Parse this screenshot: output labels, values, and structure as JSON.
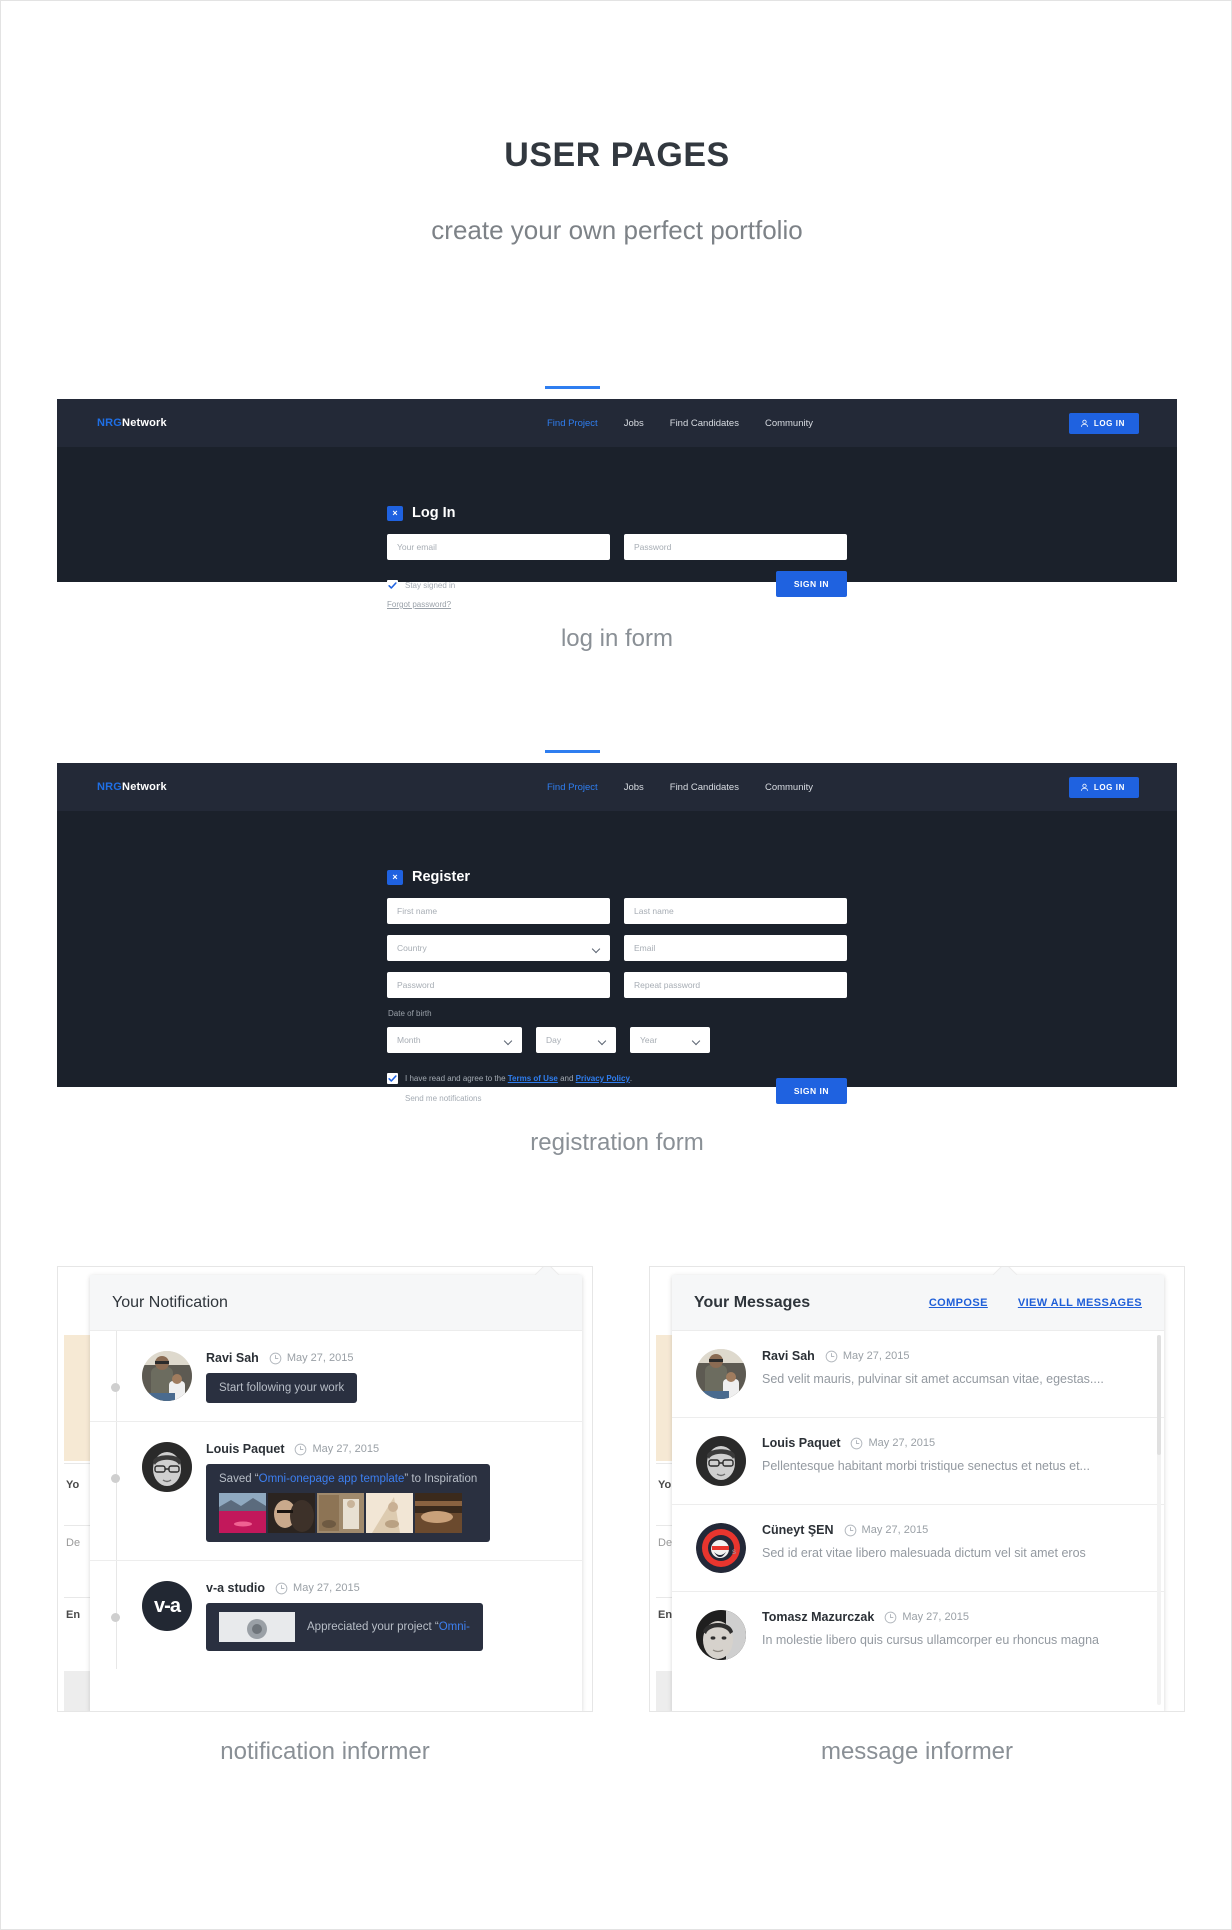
{
  "hero": {
    "title": "USER PAGES",
    "subtitle": "create your own perfect portfolio"
  },
  "captions": {
    "login": "log in form",
    "register": "registration form",
    "notification": "notification informer",
    "message": "message informer"
  },
  "navbar": {
    "brand_primary": "NRG",
    "brand_secondary": "Network",
    "links": [
      {
        "label": "Find Project",
        "active": true
      },
      {
        "label": "Jobs",
        "active": false
      },
      {
        "label": "Find Candidates",
        "active": false
      },
      {
        "label": "Community",
        "active": false
      }
    ],
    "login_button": "LOG IN",
    "accent_color": "#2f7ef0",
    "bar_color": "#232937"
  },
  "login_form": {
    "title": "Log In",
    "close_glyph": "×",
    "email_placeholder": "Your email",
    "password_placeholder": "Password",
    "stay_signed_in": "Stay signed in",
    "forgot": "Forgot password?",
    "submit": "SIGN IN"
  },
  "register_form": {
    "title": "Register",
    "close_glyph": "×",
    "first_name_placeholder": "First name",
    "last_name_placeholder": "Last name",
    "country_placeholder": "Country",
    "email_placeholder": "Email",
    "password_placeholder": "Password",
    "repeat_password_placeholder": "Repeat password",
    "dob_label": "Date of birth",
    "month_placeholder": "Month",
    "day_placeholder": "Day",
    "year_placeholder": "Year",
    "terms_prefix": "I have read and agree to the ",
    "terms_link": "Terms of Use",
    "terms_mid": " and ",
    "privacy_link": "Privacy Policy",
    "terms_suffix": ".",
    "notifications_label": "Send me notifications",
    "submit": "SIGN IN"
  },
  "notification_panel": {
    "title": "Your Notification",
    "background_text": [
      "Yo",
      "De",
      "En"
    ],
    "items": [
      {
        "name": "Ravi Sah",
        "date": "May 27, 2015",
        "message": "Start following your work",
        "has_thumbs": false
      },
      {
        "name": "Louis Paquet",
        "date": "May 27, 2015",
        "message_prefix": "Saved “",
        "message_link": "Omni-onepage app template",
        "message_suffix": "” to Inspiration",
        "has_thumbs": true
      },
      {
        "name": "v-a studio",
        "avatar_text": "v-a",
        "date": "May 27, 2015",
        "message_prefix": "Appreciated your project “",
        "message_link": "Omni-",
        "has_thumbs": false
      }
    ]
  },
  "message_panel": {
    "title": "Your Messages",
    "actions": [
      "COMPOSE",
      "VIEW ALL MESSAGES"
    ],
    "items": [
      {
        "name": "Ravi Sah",
        "date": "May 27, 2015",
        "preview": "Sed velit mauris, pulvinar sit amet accumsan vitae, egestas...."
      },
      {
        "name": "Louis Paquet",
        "date": "May 27, 2015",
        "preview": "Pellentesque habitant morbi tristique senectus et netus et..."
      },
      {
        "name": "Cüneyt ŞEN",
        "date": "May 27, 2015",
        "preview": "Sed id erat vitae libero malesuada dictum vel sit amet eros"
      },
      {
        "name": "Tomasz Mazurczak",
        "date": "May 27, 2015",
        "preview": "In molestie libero quis cursus ullamcorper eu rhoncus magna"
      }
    ]
  }
}
